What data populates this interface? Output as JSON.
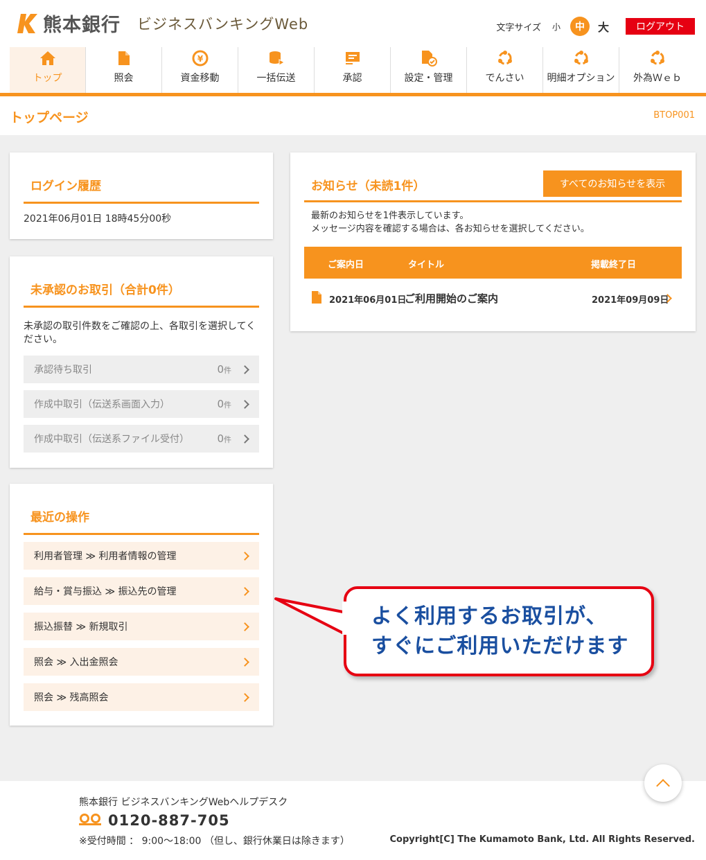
{
  "header": {
    "bank_name": "熊本銀行",
    "service_name": "ビジネスバンキングWeb",
    "font_size_label": "文字サイズ",
    "font_sizes": [
      "小",
      "中",
      "大"
    ],
    "font_size_selected": "中",
    "logout_label": "ログアウト"
  },
  "nav": {
    "items": [
      {
        "label": "トップ",
        "icon": "home-icon",
        "active": true
      },
      {
        "label": "照会",
        "icon": "document-icon"
      },
      {
        "label": "資金移動",
        "icon": "yen-transfer-icon"
      },
      {
        "label": "一括伝送",
        "icon": "database-upload-icon"
      },
      {
        "label": "承認",
        "icon": "stamp-icon"
      },
      {
        "label": "設定・管理",
        "icon": "settings-document-icon"
      },
      {
        "label": "でんさい",
        "icon": "network-circle-icon"
      },
      {
        "label": "明細オプション",
        "icon": "network-circle-icon"
      },
      {
        "label": "外為Ｗｅｂ",
        "icon": "network-circle-icon"
      }
    ]
  },
  "page": {
    "title": "トップページ",
    "code": "BTOP001"
  },
  "login_history": {
    "title": "ログイン履歴",
    "value": "2021年06月01日 18時45分00秒"
  },
  "pending": {
    "title": "未承認のお取引（合計0件）",
    "description": "未承認の取引件数をご確認の上、各取引を選択してください。",
    "rows": [
      {
        "label": "承認待ち取引",
        "count": "0",
        "unit": "件"
      },
      {
        "label": "作成中取引（伝送系画面入力）",
        "count": "0",
        "unit": "件"
      },
      {
        "label": "作成中取引（伝送系ファイル受付）",
        "count": "0",
        "unit": "件"
      }
    ]
  },
  "recent": {
    "title": "最近の操作",
    "rows": [
      "利用者管理 ≫ 利用者情報の管理",
      "給与・賞与振込 ≫ 振込先の管理",
      "振込振替 ≫ 新規取引",
      "照会 ≫ 入出金照会",
      "照会 ≫ 残高照会"
    ]
  },
  "notices": {
    "title": "お知らせ（未読1件）",
    "all_button": "すべてのお知らせを表示",
    "desc_line1": "最新のお知らせを1件表示しています。",
    "desc_line2": "メッセージ内容を確認する場合は、各お知らせを選択してください。",
    "columns": [
      "ご案内日",
      "タイトル",
      "掲載終了日"
    ],
    "rows": [
      {
        "date": "2021年06月01日",
        "title": "ご利用開始のご案内",
        "end_date": "2021年09月09日"
      }
    ]
  },
  "callout": {
    "line1": "よく利用するお取引が、",
    "line2": "すぐにご利用いただけます"
  },
  "footer": {
    "helpdesk": "熊本銀行 ビジネスバンキングWebヘルプデスク",
    "phone": "0120-887-705",
    "hours": "※受付時間 ： 9:00～18:00 （但し、銀行休業日は除きます）",
    "copyright": "Copyright[C] The Kumamoto Bank, Ltd. All Rights Reserved."
  },
  "colors": {
    "accent": "#f7931e",
    "logout": "#e60012",
    "callout_text": "#1a4fa0",
    "callout_border": "#e60012"
  }
}
